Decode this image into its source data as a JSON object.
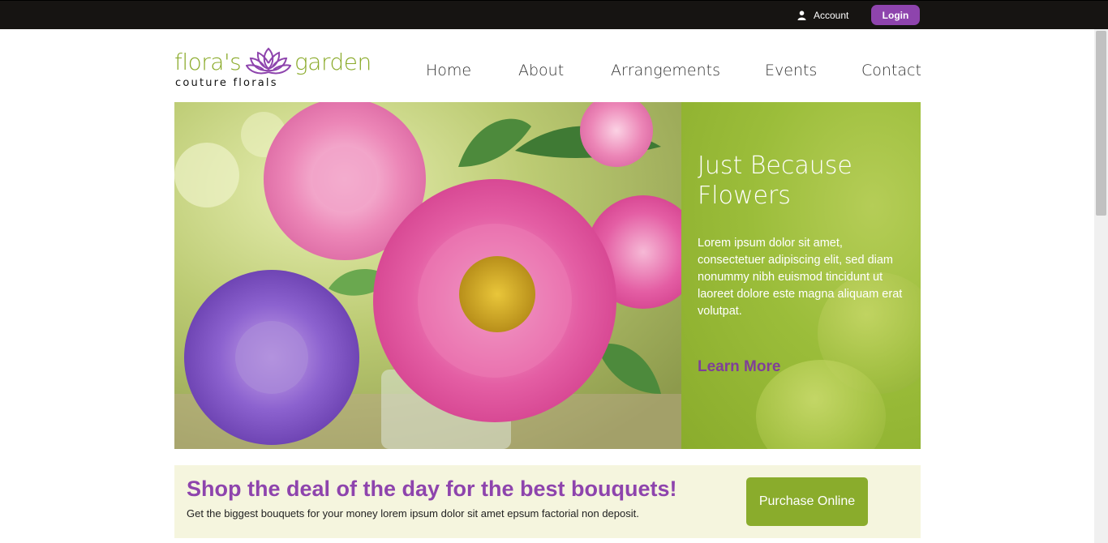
{
  "topbar": {
    "account_label": "Account",
    "account_icon": "user-icon",
    "login_label": "Login"
  },
  "logo": {
    "word_left": "flora's",
    "word_right": "garden",
    "tagline": "couture florals",
    "icon": "lotus-icon"
  },
  "nav": {
    "items": [
      {
        "label": "Home"
      },
      {
        "label": "About"
      },
      {
        "label": "Arrangements"
      },
      {
        "label": "Events"
      },
      {
        "label": "Contact"
      }
    ]
  },
  "hero": {
    "title": "Just Because Flowers",
    "text": "Lorem ipsum dolor sit amet, consectetuer adipiscing elit, sed diam nonummy nibh euismod tincidunt ut laoreet dolore este magna aliquam erat volutpat.",
    "link_label": "Learn More"
  },
  "promo": {
    "title": "Shop the deal of the day for the best bouquets!",
    "text": "Get the biggest bouquets for your money lorem ipsum dolor sit amet epsum factorial non deposit.",
    "button_label": "Purchase Online"
  },
  "colors": {
    "accent_purple": "#8e44ad",
    "accent_green": "#8aac2c",
    "topbar": "#161412",
    "promo_bg": "#f5f5de"
  }
}
